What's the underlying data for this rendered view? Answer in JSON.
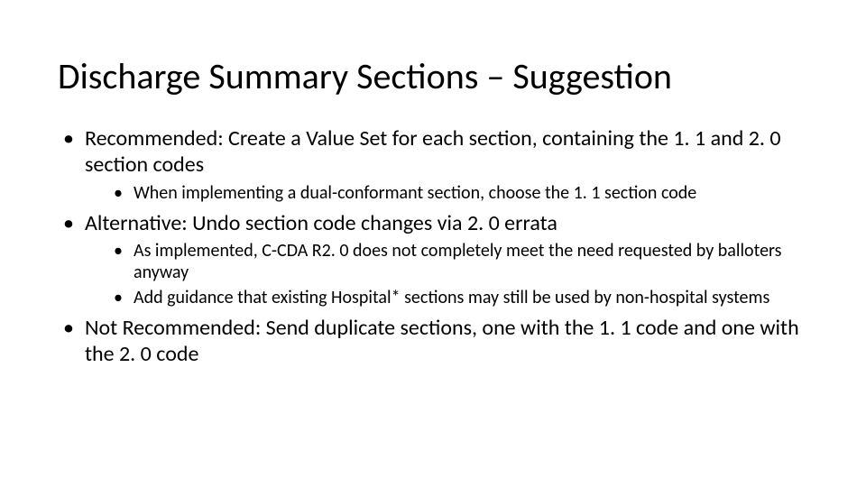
{
  "title": "Discharge Summary Sections – Suggestion",
  "bullets": [
    {
      "text": "Recommended: Create a Value Set for each section, containing the 1. 1 and 2. 0 section codes",
      "children": [
        {
          "text": "When implementing a dual-conformant section, choose the 1. 1 section code"
        }
      ]
    },
    {
      "text": "Alternative: Undo section code changes via 2. 0 errata",
      "children": [
        {
          "text": "As implemented, C-CDA R2. 0 does not completely meet the need requested by balloters anyway"
        },
        {
          "text": "Add guidance that existing Hospital* sections may still be used by non-hospital systems"
        }
      ]
    },
    {
      "text": "Not Recommended: Send duplicate sections, one with the 1. 1 code and one with the 2. 0 code",
      "children": []
    }
  ]
}
